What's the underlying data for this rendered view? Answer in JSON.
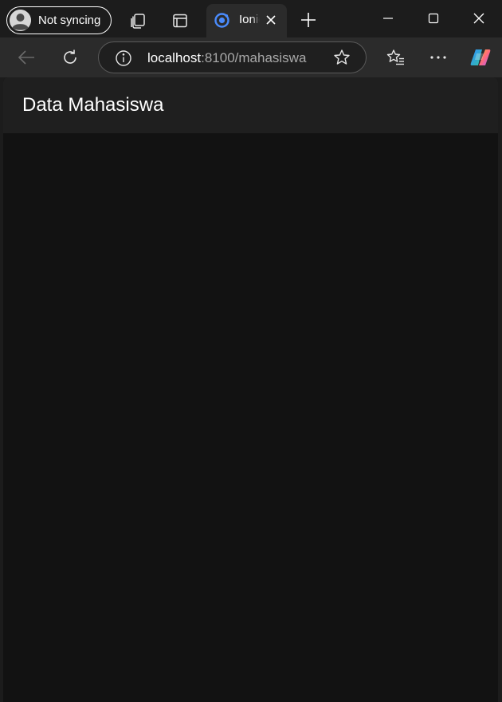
{
  "browser": {
    "profile": {
      "label": "Not syncing"
    },
    "tab": {
      "title": "Ionic"
    },
    "address_bar": {
      "host": "localhost",
      "rest": ":8100/mahasiswa"
    }
  },
  "page": {
    "header_title": "Data Mahasiswa"
  },
  "colors": {
    "titlebar": "#1c1c1c",
    "toolbar": "#2b2b2b",
    "page_background": "#121212",
    "app_header": "#1f1f1f",
    "ionic_blue": "#4a8bfc"
  }
}
